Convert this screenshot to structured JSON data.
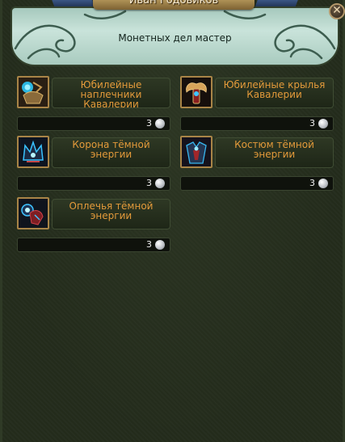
{
  "window": {
    "title": "Иван Годовиков",
    "subtitle": "Монетных дел мастер",
    "close_label": "✕"
  },
  "items": [
    {
      "name": "Юбилейные наплечники Кавалерии",
      "price": "3",
      "icon": "shoulder-armor-icon"
    },
    {
      "name": "Юбилейные крылья Кавалерии",
      "price": "3",
      "icon": "wings-icon"
    },
    {
      "name": "Корона тёмной энергии",
      "price": "3",
      "icon": "dark-crown-icon"
    },
    {
      "name": "Костюм тёмной энергии",
      "price": "3",
      "icon": "dark-costume-icon"
    },
    {
      "name": "Оплечья тёмной энергии",
      "price": "3",
      "icon": "dark-pauldrons-icon"
    }
  ],
  "currency_icon": "silver-coin-icon",
  "colors": {
    "item_name": "#e39a3a",
    "banner": "#c9e3da",
    "panel_bg": "#242c1c",
    "icon_border": "#a88447"
  }
}
